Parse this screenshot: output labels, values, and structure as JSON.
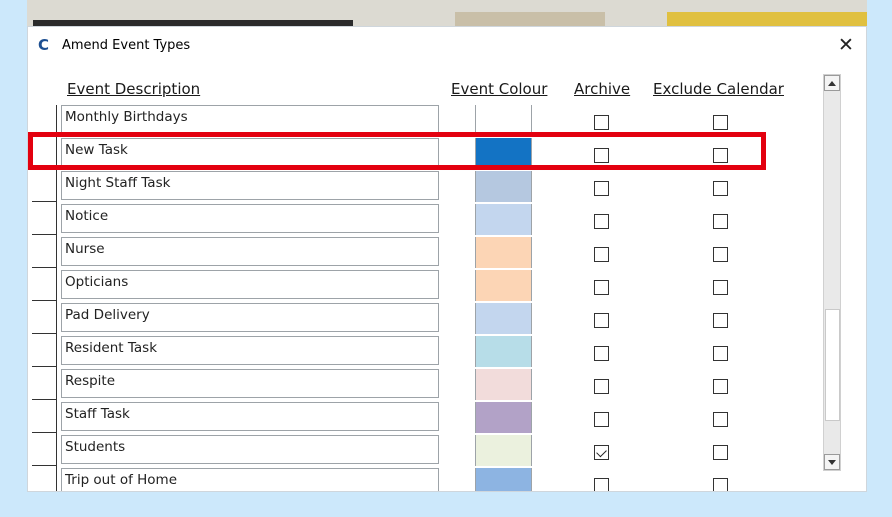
{
  "window": {
    "app_icon": "C",
    "title": "Amend Event Types",
    "close_glyph": "✕"
  },
  "headers": {
    "description": "Event Description",
    "colour": "Event Colour",
    "archive": "Archive",
    "exclude": "Exclude Calendar"
  },
  "rows": [
    {
      "label": "Monthly Birthdays",
      "colour": "#ffffff",
      "archive": false,
      "exclude": false
    },
    {
      "label": "New Task",
      "colour": "#1373c4",
      "archive": false,
      "exclude": false
    },
    {
      "label": "Night Staff Task",
      "colour": "#b5c8e0",
      "archive": false,
      "exclude": false
    },
    {
      "label": "Notice",
      "colour": "#c3d6ee",
      "archive": false,
      "exclude": false
    },
    {
      "label": "Nurse",
      "colour": "#fcd5b5",
      "archive": false,
      "exclude": false
    },
    {
      "label": "Opticians",
      "colour": "#fcd5b5",
      "archive": false,
      "exclude": false
    },
    {
      "label": "Pad Delivery",
      "colour": "#c3d6ee",
      "archive": false,
      "exclude": false
    },
    {
      "label": "Resident Task",
      "colour": "#b7dde8",
      "archive": false,
      "exclude": false
    },
    {
      "label": "Respite",
      "colour": "#f2dcdb",
      "archive": false,
      "exclude": false
    },
    {
      "label": "Staff Task",
      "colour": "#b2a2c7",
      "archive": false,
      "exclude": false
    },
    {
      "label": "Students",
      "colour": "#ebf1de",
      "archive": true,
      "exclude": false
    },
    {
      "label": "Trip out of Home",
      "colour": "#8db4e2",
      "archive": false,
      "exclude": false
    }
  ],
  "highlighted_row": "New Task",
  "highlight_colour": "#e3000f"
}
